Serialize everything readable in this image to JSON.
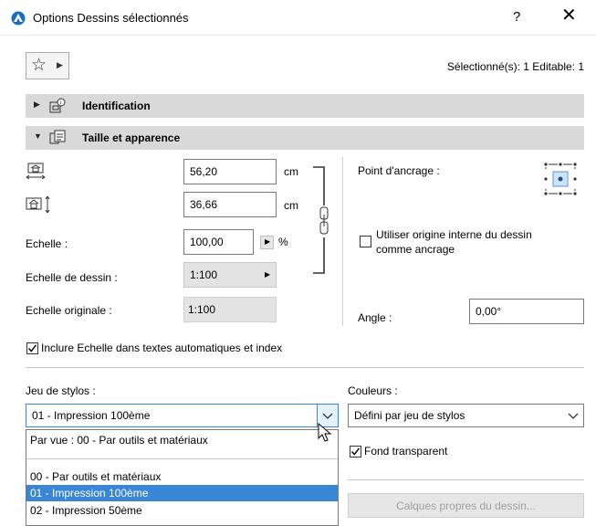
{
  "window": {
    "title": "Options Dessins sélectionnés",
    "help": "?",
    "close": "✕"
  },
  "header": {
    "selection_status": "Sélectionné(s): 1 Editable: 1"
  },
  "panels": {
    "identification": {
      "label": "Identification"
    },
    "size": {
      "label": "Taille et apparence"
    }
  },
  "size": {
    "width_value": "56,20",
    "width_unit": "cm",
    "height_value": "36,66",
    "height_unit": "cm",
    "scale_label": "Echelle :",
    "scale_value": "100,00",
    "scale_unit": "%",
    "drawing_scale_label": "Echelle de dessin :",
    "drawing_scale_value": "1:100",
    "original_scale_label": "Echelle originale :",
    "original_scale_value": "1:100",
    "anchor_label": "Point d'ancrage :",
    "use_origin_label_1": "Utiliser origine interne du dessin",
    "use_origin_label_2": "comme ancrage",
    "angle_label": "Angle :",
    "angle_value": "0,00°",
    "include_scale_label": "Inclure Echelle dans textes automatiques et index"
  },
  "pens": {
    "pen_set_label": "Jeu de stylos :",
    "pen_set_value": "01 - Impression 100ème",
    "colors_label": "Couleurs :",
    "colors_value": "Défini par jeu de stylos",
    "transparent_label": "Fond transparent",
    "layers_button": "Calques propres du dessin...",
    "dropdown_items": [
      "Par vue : 00 - Par outils et matériaux",
      "00 - Par outils et matériaux",
      "01 - Impression 100ème",
      "02 - Impression 50ème"
    ]
  },
  "colors": {
    "selection": "#3a86d6",
    "panel": "#d9d9d9",
    "accent": "#1a6ec2"
  }
}
